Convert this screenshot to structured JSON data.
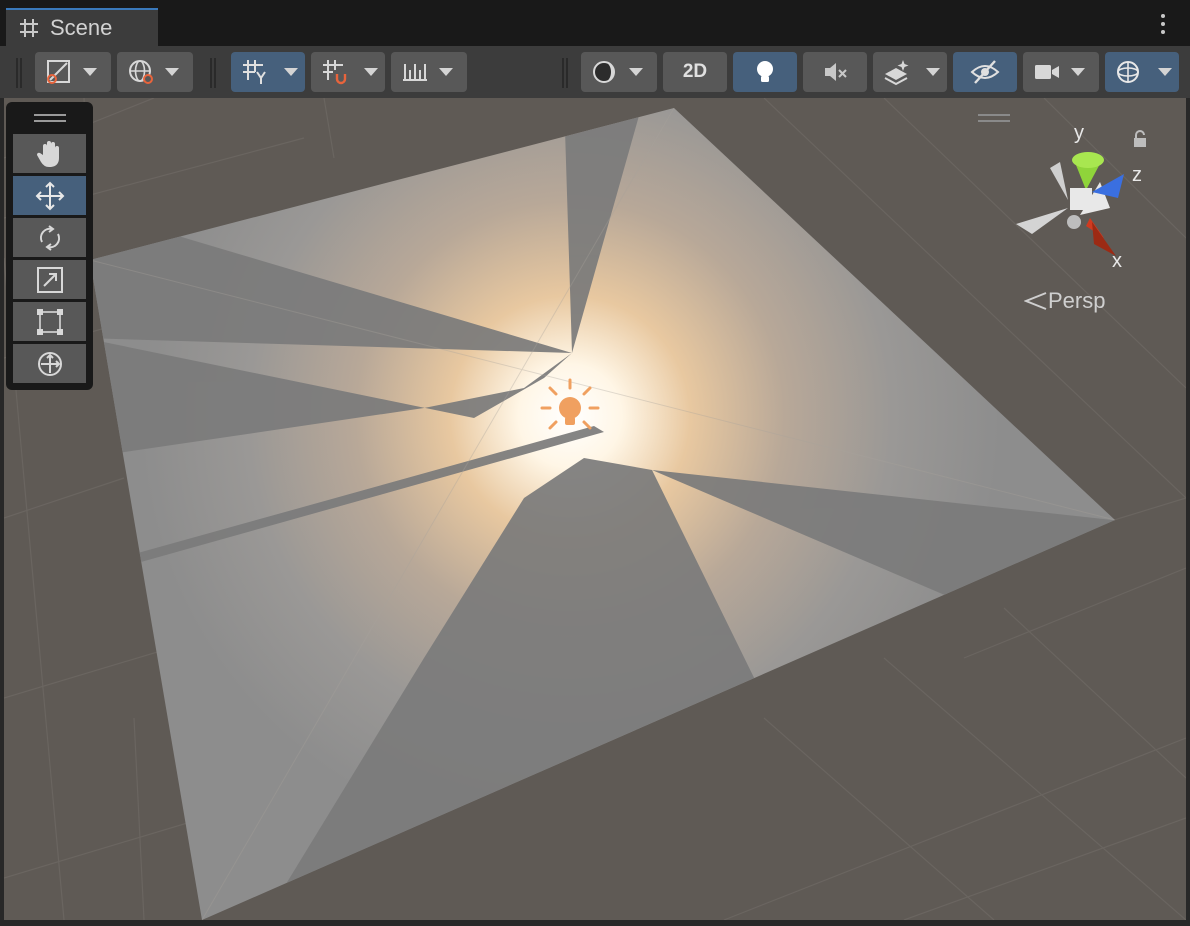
{
  "window": {
    "tab_title": "Scene"
  },
  "icons": {
    "tab": "grid-hash-icon",
    "menu": "kebab-menu-icon",
    "light": "point-light-icon",
    "lock": "lock-icon"
  },
  "toolbar": {
    "btn_2d": "2D"
  },
  "gizmo": {
    "y": "y",
    "z": "z",
    "x": "x",
    "projection": "Persp"
  },
  "colors": {
    "accent": "#3a79bb",
    "active_button": "#46607c",
    "button": "#585858",
    "toolbar_bg": "#3c3c3c",
    "axis_x": "#d03a20",
    "axis_y": "#8fd43a",
    "axis_z": "#3a6fe0",
    "light_icon": "#f0a060"
  }
}
